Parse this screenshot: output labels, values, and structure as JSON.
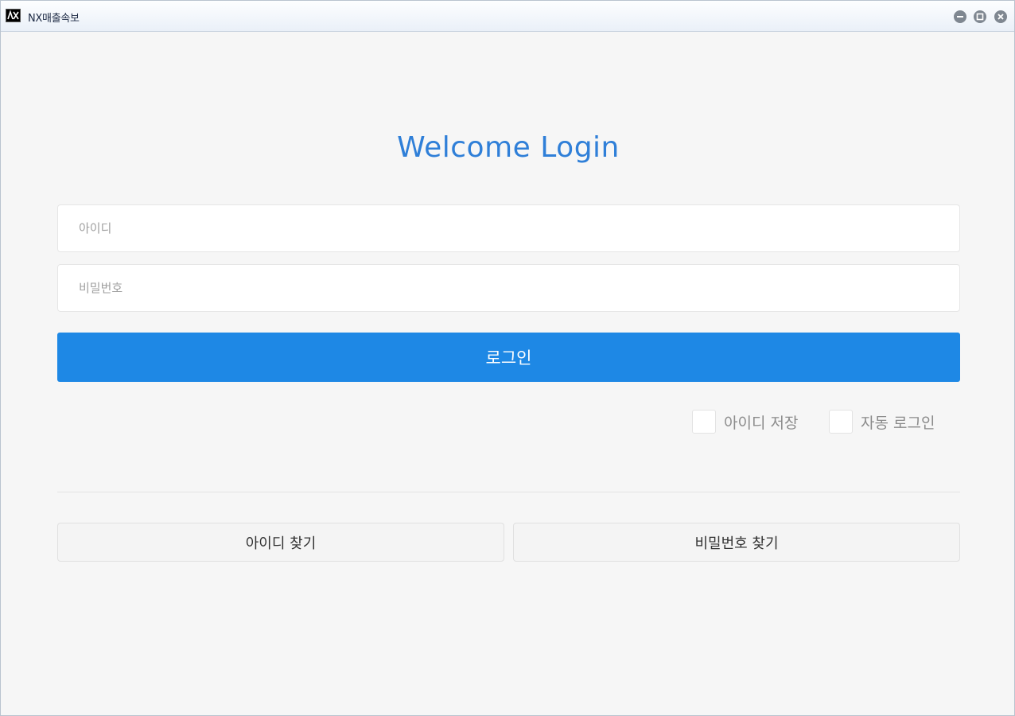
{
  "window": {
    "title": "NX매출속보",
    "icon": "app-logo-icon",
    "controls": [
      "minimize-icon",
      "maximize-icon",
      "close-icon"
    ]
  },
  "login": {
    "heading": "Welcome Login",
    "id_placeholder": "아이디",
    "id_value": "",
    "password_placeholder": "비밀번호",
    "password_value": "",
    "login_label": "로그인",
    "save_id_label": "아이디 저장",
    "save_id_checked": false,
    "auto_login_label": "자동 로그인",
    "auto_login_checked": false,
    "find_id_label": "아이디 찾기",
    "find_password_label": "비밀번호 찾기"
  },
  "colors": {
    "accent": "#1e88e5",
    "heading": "#2f7fd8",
    "background": "#f6f6f6"
  }
}
